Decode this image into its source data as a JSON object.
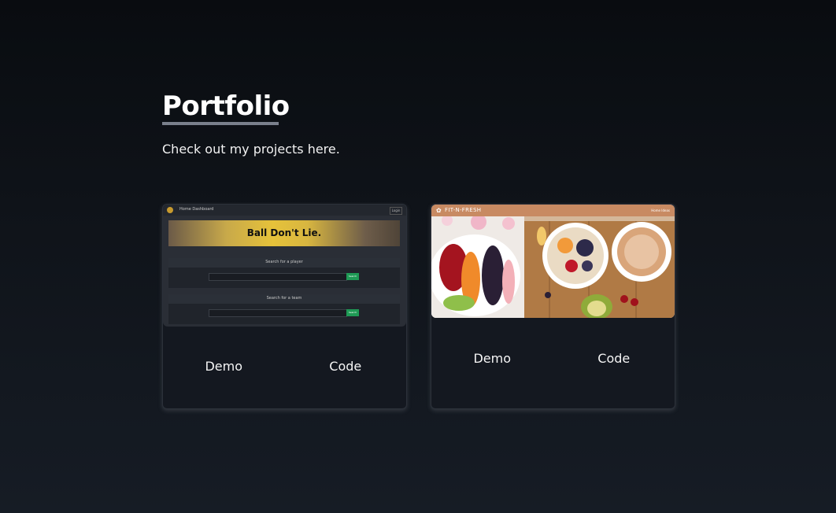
{
  "section": {
    "title": "Portfolio",
    "subtitle": "Check out my projects here."
  },
  "projects": [
    {
      "thumbnail": {
        "nav_text": "Home Dashboard",
        "nav_button": "Login",
        "banner_text": "Ball Don't Lie.",
        "panel1_title": "Search for a player",
        "panel2_title": "Search for a team",
        "button_label": "Search"
      },
      "demo_label": "Demo",
      "code_label": "Code"
    },
    {
      "thumbnail": {
        "brand": "FIT-N-FRESH",
        "nav_links": "Home  Ideas"
      },
      "demo_label": "Demo",
      "code_label": "Code"
    }
  ],
  "colors": {
    "background_top": "#090c10",
    "background_bottom": "#161c25",
    "underline": "#7a808c",
    "card_bg": "#141820",
    "thumb2_nav": "#c88a62",
    "thumb1_button": "#1f9a55"
  }
}
